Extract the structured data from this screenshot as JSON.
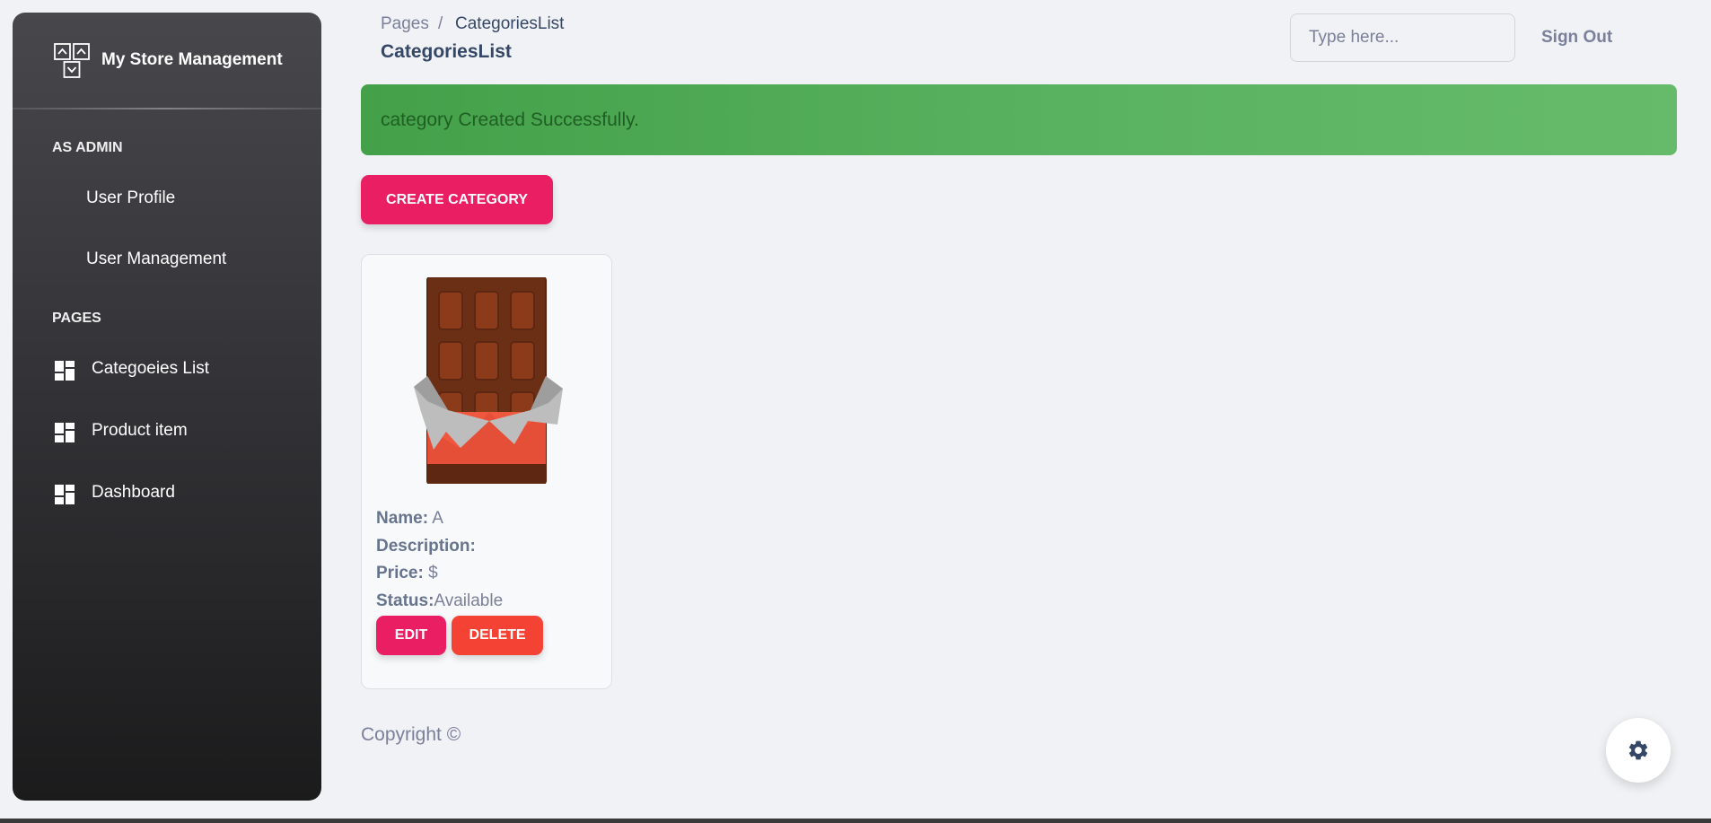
{
  "sidebar": {
    "brand": "My Store Management",
    "sections": [
      {
        "heading": "AS ADMIN",
        "items": [
          {
            "label": "User Profile"
          },
          {
            "label": "User Management"
          }
        ]
      },
      {
        "heading": "PAGES",
        "items": [
          {
            "label": "Categoeies List",
            "icon": "dashboard-icon"
          },
          {
            "label": "Product item",
            "icon": "dashboard-icon"
          },
          {
            "label": "Dashboard",
            "icon": "dashboard-icon"
          }
        ]
      }
    ]
  },
  "header": {
    "breadcrumb_root": "Pages",
    "breadcrumb_separator": "/",
    "breadcrumb_current": "CategoriesList",
    "title": "CategoriesList",
    "search_placeholder": "Type here...",
    "signout_label": "Sign Out"
  },
  "alert": {
    "message": "category Created Successfully.",
    "color": "#4caf50"
  },
  "create_button": "CREATE CATEGORY",
  "card": {
    "image": "chocolate-bar-icon",
    "name_label": "Name:",
    "name_value": " A",
    "description_label": "Description:",
    "description_value": "",
    "price_label": "Price:",
    "price_value": " $",
    "status_label": "Status:",
    "status_value": "Available",
    "edit_label": "EDIT",
    "delete_label": "DELETE"
  },
  "footer": {
    "copyright": "Copyright ©"
  },
  "settings_icon": "gear-icon",
  "colors": {
    "primary": "#e91e63",
    "danger": "#f44335",
    "success": "#4caf50",
    "sidebar_dark": "#1b1b1c",
    "text_heading": "#344767",
    "text_muted": "#7b809a"
  }
}
